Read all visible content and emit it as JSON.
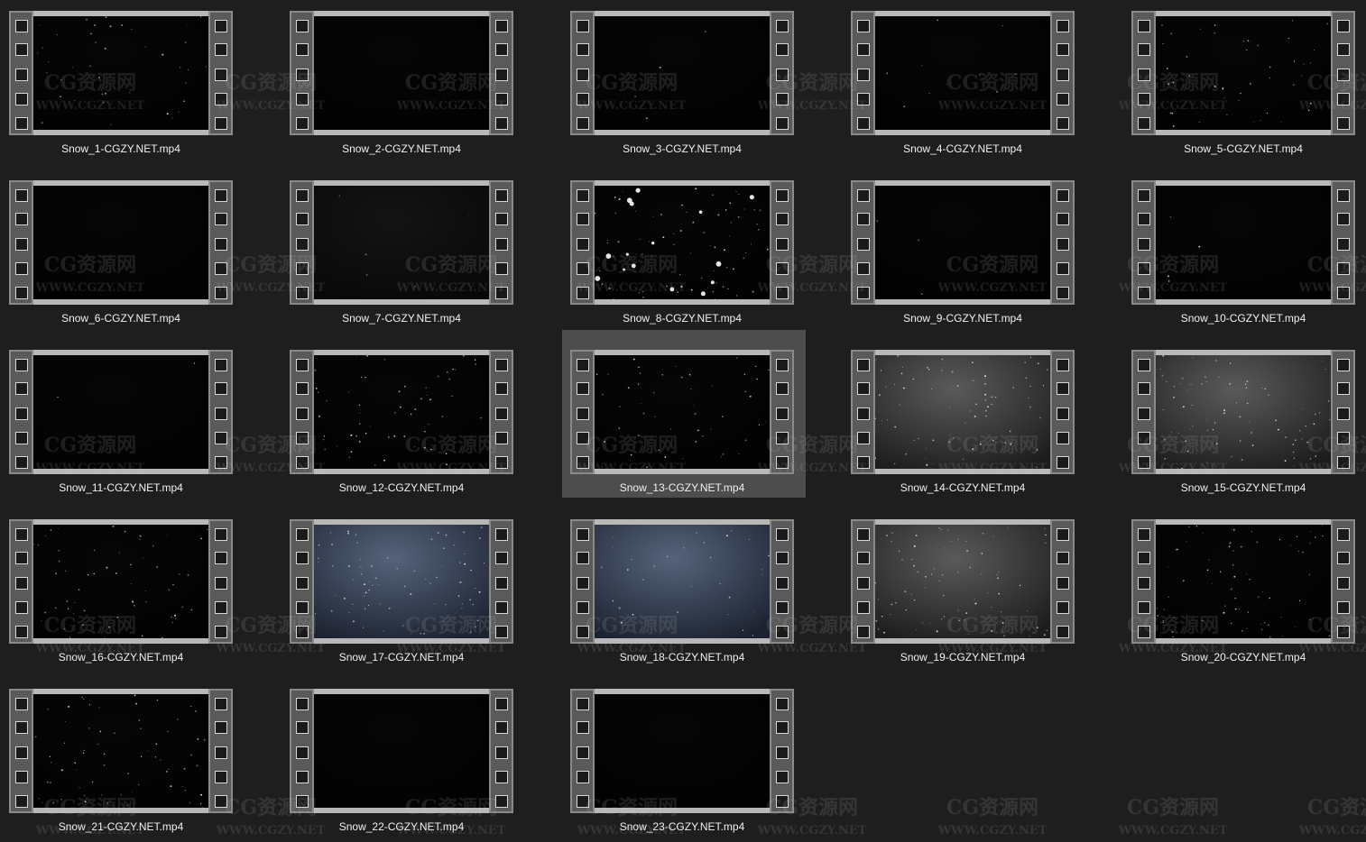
{
  "files": [
    {
      "name": "Snow_1-CGZY.NET.mp4",
      "tone": "black",
      "specks": 40,
      "selected": false
    },
    {
      "name": "Snow_2-CGZY.NET.mp4",
      "tone": "black",
      "specks": 0,
      "selected": false
    },
    {
      "name": "Snow_3-CGZY.NET.mp4",
      "tone": "black",
      "specks": 4,
      "selected": false
    },
    {
      "name": "Snow_4-CGZY.NET.mp4",
      "tone": "black",
      "specks": 10,
      "selected": false
    },
    {
      "name": "Snow_5-CGZY.NET.mp4",
      "tone": "black",
      "specks": 45,
      "selected": false
    },
    {
      "name": "Snow_6-CGZY.NET.mp4",
      "tone": "black",
      "specks": 0,
      "selected": false
    },
    {
      "name": "Snow_7-CGZY.NET.mp4",
      "tone": "dark",
      "specks": 6,
      "selected": false
    },
    {
      "name": "Snow_8-CGZY.NET.mp4",
      "tone": "black",
      "specks": 90,
      "selected": false
    },
    {
      "name": "Snow_9-CGZY.NET.mp4",
      "tone": "black",
      "specks": 3,
      "selected": false
    },
    {
      "name": "Snow_10-CGZY.NET.mp4",
      "tone": "black",
      "specks": 4,
      "selected": false
    },
    {
      "name": "Snow_11-CGZY.NET.mp4",
      "tone": "black",
      "specks": 2,
      "selected": false
    },
    {
      "name": "Snow_12-CGZY.NET.mp4",
      "tone": "black",
      "specks": 60,
      "selected": false
    },
    {
      "name": "Snow_13-CGZY.NET.mp4",
      "tone": "black",
      "specks": 50,
      "selected": true
    },
    {
      "name": "Snow_14-CGZY.NET.mp4",
      "tone": "gray",
      "specks": 80,
      "selected": false
    },
    {
      "name": "Snow_15-CGZY.NET.mp4",
      "tone": "gray",
      "specks": 80,
      "selected": false
    },
    {
      "name": "Snow_16-CGZY.NET.mp4",
      "tone": "black",
      "specks": 60,
      "selected": false
    },
    {
      "name": "Snow_17-CGZY.NET.mp4",
      "tone": "blue",
      "specks": 80,
      "selected": false
    },
    {
      "name": "Snow_18-CGZY.NET.mp4",
      "tone": "blue",
      "specks": 30,
      "selected": false
    },
    {
      "name": "Snow_19-CGZY.NET.mp4",
      "tone": "gray",
      "specks": 80,
      "selected": false
    },
    {
      "name": "Snow_20-CGZY.NET.mp4",
      "tone": "black",
      "specks": 70,
      "selected": false
    },
    {
      "name": "Snow_21-CGZY.NET.mp4",
      "tone": "black",
      "specks": 70,
      "selected": false
    },
    {
      "name": "Snow_22-CGZY.NET.mp4",
      "tone": "black",
      "specks": 0,
      "selected": false
    },
    {
      "name": "Snow_23-CGZY.NET.mp4",
      "tone": "black",
      "specks": 0,
      "selected": false
    }
  ],
  "watermark": {
    "title": "CG资源网",
    "url": "WWW.CGZY.NET"
  },
  "icon": "video-file-icon",
  "colors": {
    "background": "#1e1e1e",
    "selection": "#4d4d4d",
    "caption": "#f0f0f0"
  }
}
